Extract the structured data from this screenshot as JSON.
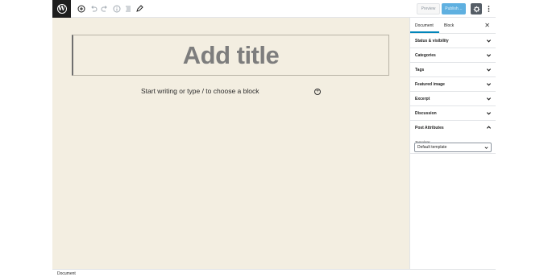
{
  "toolbar": {
    "icons": [
      "wordpress-logo-icon",
      "add-block-icon",
      "undo-icon",
      "redo-icon",
      "info-icon",
      "outline-icon",
      "edit-tools-icon"
    ],
    "preview_label": "Preview",
    "publish_label": "Publish…",
    "settings_icon": "gear-icon",
    "more_icon": "more-vertical-icon"
  },
  "editor": {
    "title_placeholder": "Add title",
    "block_placeholder": "Start writing or type / to choose a block",
    "background": "#f3eee1"
  },
  "sidebar": {
    "tabs": [
      "Document",
      "Block"
    ],
    "close": "✕",
    "panels": [
      {
        "label": "Status & visibility"
      },
      {
        "label": "Categories"
      },
      {
        "label": "Tags"
      },
      {
        "label": "Featured image"
      },
      {
        "label": "Excerpt"
      },
      {
        "label": "Discussion"
      },
      {
        "label": "Post Attributes"
      }
    ],
    "template_label": "Template:",
    "template_value": "Default template"
  },
  "status_bar": {
    "breadcrumb": "Document"
  },
  "colors": {
    "accent": "#0085ba",
    "publish": "#5fb0e0",
    "settings_bg": "#555d66"
  }
}
